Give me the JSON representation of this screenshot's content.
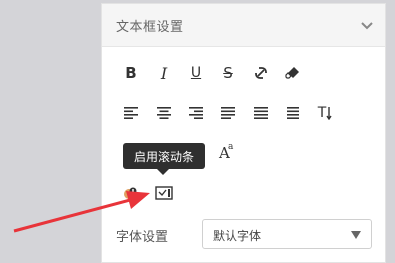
{
  "panel": {
    "title": "文本框设置"
  },
  "toolbar": {
    "row1": [
      {
        "name": "bold-button",
        "icon": "bold-icon",
        "glyph": "B"
      },
      {
        "name": "italic-button",
        "icon": "italic-icon",
        "glyph": "I"
      },
      {
        "name": "underline-button",
        "icon": "underline-icon",
        "glyph": "U"
      },
      {
        "name": "strikethrough-button",
        "icon": "strikethrough-icon",
        "glyph": "S"
      },
      {
        "name": "unlink-button",
        "icon": "unlink-icon"
      },
      {
        "name": "clear-format-button",
        "icon": "eraser-icon"
      }
    ],
    "row2": [
      {
        "name": "align-left-button",
        "icon": "align-left-icon"
      },
      {
        "name": "align-center-button",
        "icon": "align-center-icon"
      },
      {
        "name": "align-right-button",
        "icon": "align-right-icon"
      },
      {
        "name": "justify-button",
        "icon": "align-justify-icon"
      },
      {
        "name": "distribute-button",
        "icon": "align-distribute-icon"
      },
      {
        "name": "line-spacing-button",
        "icon": "line-spacing-icon"
      },
      {
        "name": "text-direction-button",
        "icon": "text-direction-icon",
        "glyph": "T"
      }
    ],
    "row3": [
      {
        "name": "font-size-button",
        "icon": "font-size-icon",
        "glyph": "A",
        "superscript": "a"
      }
    ],
    "row4": [
      {
        "name": "text-color-button",
        "icon": "text-color-icon"
      },
      {
        "name": "enable-scrollbar-button",
        "icon": "scrollbar-icon"
      }
    ]
  },
  "tooltip": {
    "text": "启用滚动条"
  },
  "font_setting": {
    "label": "字体设置",
    "value": "默认字体"
  },
  "colors": {
    "annotation_arrow": "#e8343a",
    "tooltip_bg": "#2f2f2f"
  }
}
